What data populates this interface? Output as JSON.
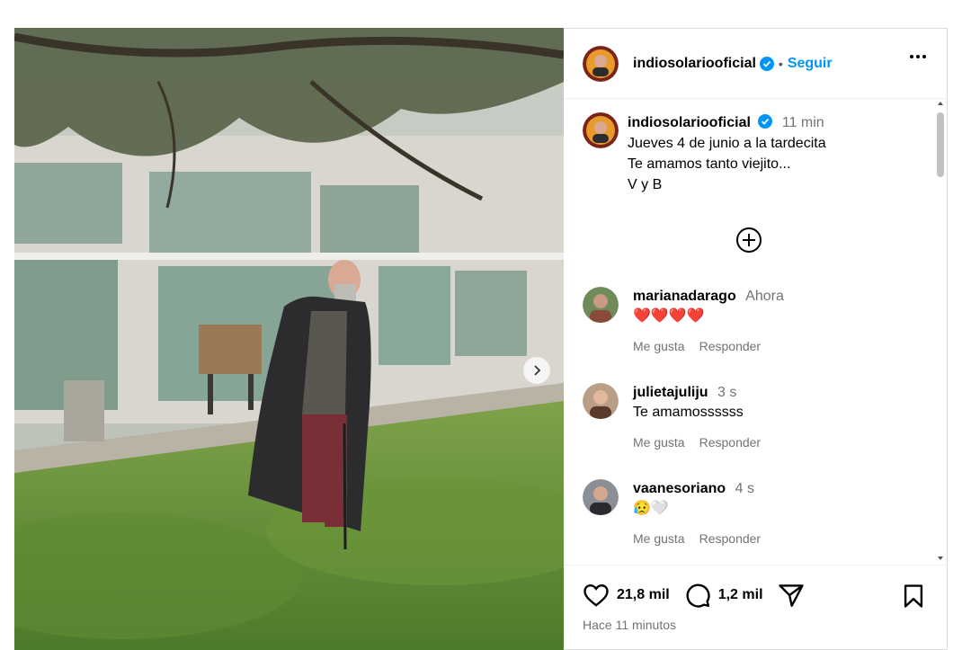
{
  "post": {
    "username": "indiosolariooficial",
    "follow_label": "Seguir",
    "dot": "•",
    "caption_time": "11 min",
    "caption_lines": [
      "Jueves 4 de junio a la tardecita",
      "Te amamos tanto viejito...",
      "V y B"
    ],
    "likes": "21,8 mil",
    "comments_count": "1,2 mil",
    "posted_ago": "Hace 11 minutos"
  },
  "comments": [
    {
      "username": "marianadarago",
      "time": "Ahora",
      "text": "❤️❤️❤️❤️",
      "like_label": "Me gusta",
      "reply_label": "Responder"
    },
    {
      "username": "julietajuliju",
      "time": "3 s",
      "text": "Te amamossssss",
      "like_label": "Me gusta",
      "reply_label": "Responder"
    },
    {
      "username": "vaanesoriano",
      "time": "4 s",
      "text": "😥🤍",
      "like_label": "Me gusta",
      "reply_label": "Responder"
    }
  ],
  "colors": {
    "accent": "#0095f6",
    "verified": "#0095f6",
    "muted": "#737373",
    "heart": "#e0245e"
  },
  "icons": [
    "verified-badge-icon",
    "more-options-icon",
    "add-circle-icon",
    "heart-icon",
    "comment-icon",
    "share-icon",
    "bookmark-icon",
    "chevron-right-icon"
  ]
}
